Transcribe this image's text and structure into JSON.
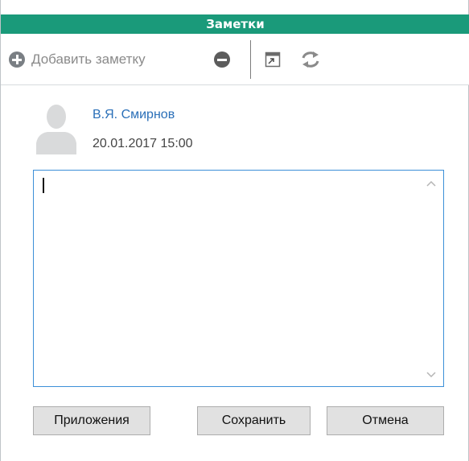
{
  "window": {
    "title": "Заметки"
  },
  "toolbar": {
    "add_label": "Добавить заметку",
    "icons": [
      "plus-circle-icon",
      "minus-circle-icon",
      "expand-window-icon",
      "refresh-icon"
    ]
  },
  "note": {
    "author": "В.Я. Смирнов",
    "timestamp": "20.01.2017 15:00",
    "text": ""
  },
  "buttons": {
    "attachments": "Приложения",
    "save": "Сохранить",
    "cancel": "Отмена"
  },
  "colors": {
    "titlebar": "#1a9a7a",
    "author_link": "#2a6fb8",
    "focus_border": "#3c8fd8"
  }
}
